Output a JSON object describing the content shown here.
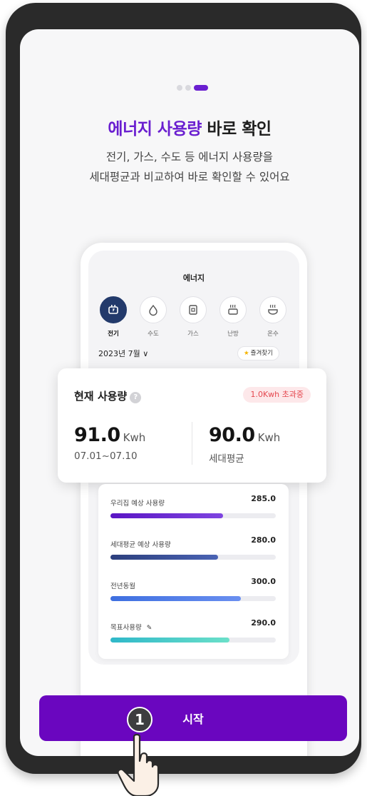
{
  "onboarding": {
    "page_indicator": {
      "count": 3,
      "active_index": 2
    },
    "headline_accent": "에너지 사용량",
    "headline_rest": "바로 확인",
    "subtitle_line1": "전기, 가스, 수도 등 에너지 사용량을",
    "subtitle_line2": "세대평균과 비교하여 바로 확인할 수 있어요"
  },
  "preview": {
    "title": "에너지",
    "categories": [
      {
        "label": "전기",
        "icon": "electricity-icon",
        "active": true
      },
      {
        "label": "수도",
        "icon": "water-drop-icon",
        "active": false
      },
      {
        "label": "가스",
        "icon": "gas-icon",
        "active": false
      },
      {
        "label": "난방",
        "icon": "heating-icon",
        "active": false
      },
      {
        "label": "온수",
        "icon": "hot-water-icon",
        "active": false
      }
    ],
    "month": "2023년 7월 ∨",
    "favorites_label": "즐겨찾기",
    "current_usage": {
      "label": "현재 사용량",
      "help": "?",
      "exceed_badge": "1.0Kwh 초과중",
      "mine": {
        "value": "91.0",
        "unit": "Kwh",
        "period": "07.01~07.10"
      },
      "average": {
        "value": "90.0",
        "unit": "Kwh",
        "caption": "세대평균"
      }
    },
    "usage_rows": [
      {
        "label": "우리집 예상 사용량",
        "value": "285.0",
        "fill": 0.68,
        "color_from": "#5a15c4",
        "color_to": "#7e44e0"
      },
      {
        "label": "세대평균 예상 사용량",
        "value": "280.0",
        "fill": 0.65,
        "color_from": "#2c3f7d",
        "color_to": "#4a63b4"
      },
      {
        "label": "전년동월",
        "value": "300.0",
        "fill": 0.79,
        "color_from": "#3e6fe0",
        "color_to": "#6a8ff0"
      },
      {
        "label": "목표사용량",
        "value": "290.0",
        "fill": 0.72,
        "color_from": "#2fb8c9",
        "color_to": "#6be0c9",
        "icon": "pencil-icon"
      }
    ]
  },
  "start_button": "시작",
  "step_marker": "1",
  "colors": {
    "accent": "#6a1fd0",
    "button": "#6a06bf",
    "warning": "#e5474f"
  }
}
